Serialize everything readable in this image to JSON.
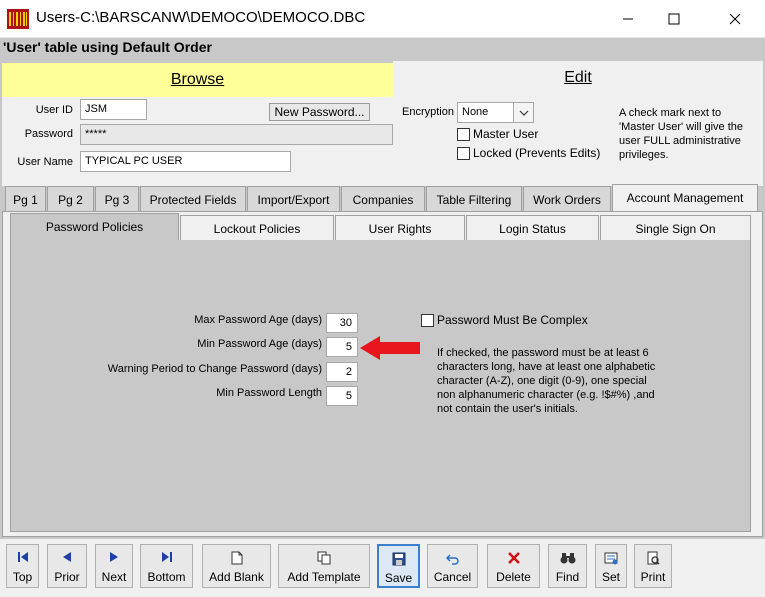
{
  "window": {
    "title": "Users-C:\\BARSCANW\\DEMOCO\\DEMOCO.DBC"
  },
  "table_title": "'User' table using Default Order",
  "modes": {
    "browse": "Browse",
    "edit": "Edit"
  },
  "form": {
    "user_id_label": "User ID",
    "user_id_value": "JSM",
    "password_label": "Password",
    "password_value": "*****",
    "user_name_label": "User Name",
    "user_name_value": "TYPICAL PC USER",
    "new_password_label": "New Password...",
    "encryption_label": "Encryption",
    "encryption_value": "None",
    "master_user_label": "Master User",
    "locked_label": "Locked (Prevents Edits)",
    "master_note": "A check mark next to 'Master User' will give the user FULL administrative privileges."
  },
  "tabs": [
    "Pg 1",
    "Pg 2",
    "Pg 3",
    "Protected Fields",
    "Import/Export",
    "Companies",
    "Table Filtering",
    "Work Orders",
    "Account Management"
  ],
  "subtabs": [
    "Password Policies",
    "Lockout Policies",
    "User Rights",
    "Login Status",
    "Single Sign On"
  ],
  "policies": {
    "max_age_label": "Max Password Age (days)",
    "max_age_value": "30",
    "min_age_label": "Min Password Age (days)",
    "min_age_value": "5",
    "warning_label": "Warning Period to Change Password (days)",
    "warning_value": "2",
    "min_length_label": "Min Password Length",
    "min_length_value": "5",
    "complex_label": "Password Must Be Complex",
    "complex_note": "If checked, the password must be at least 6 characters long, have at least one alphabetic character (A-Z), one digit (0-9), one special non alphanumeric character (e.g. !$#%) ,and not contain the user's initials."
  },
  "toolbar": [
    "Top",
    "Prior",
    "Next",
    "Bottom",
    "Add Blank",
    "Add Template",
    "Save",
    "Cancel",
    "Delete",
    "Find",
    "Set",
    "Print"
  ],
  "colors": {
    "browse_bg": "#ffff99",
    "arrow": "#e8141e",
    "save_highlight": "#3c7fd1"
  }
}
